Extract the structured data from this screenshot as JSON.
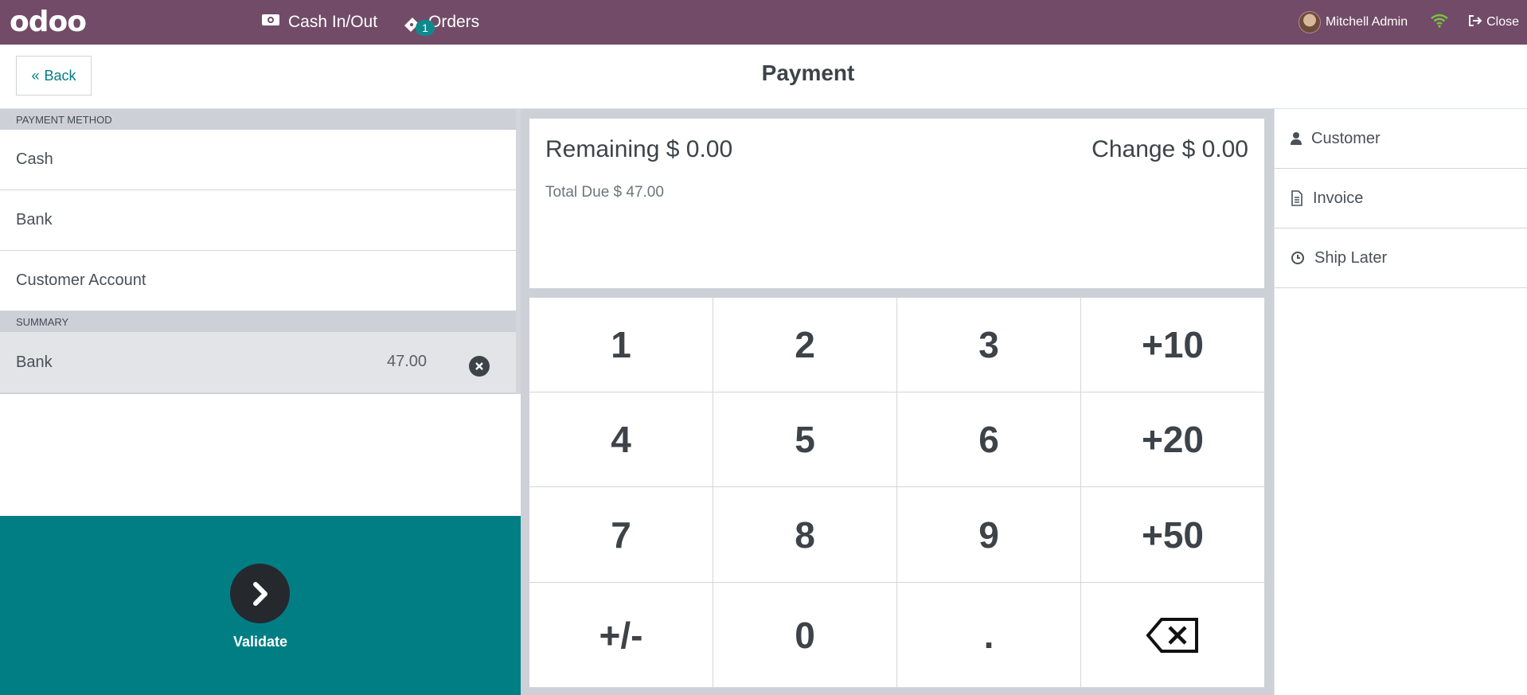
{
  "topbar": {
    "logo": "odoo",
    "cash_in_out": "Cash In/Out",
    "orders": "Orders",
    "orders_badge": "1",
    "user_name": "Mitchell Admin",
    "close": "Close"
  },
  "header": {
    "back": "Back",
    "title": "Payment"
  },
  "payment_methods": {
    "heading": "PAYMENT METHOD",
    "items": [
      "Cash",
      "Bank",
      "Customer Account"
    ]
  },
  "summary": {
    "heading": "SUMMARY",
    "line_method": "Bank",
    "line_amount": "47.00"
  },
  "validate": {
    "label": "Validate"
  },
  "status": {
    "remaining": "Remaining $ 0.00",
    "change": "Change $ 0.00",
    "total_due": "Total Due  $ 47.00"
  },
  "numpad": {
    "keys": [
      "1",
      "2",
      "3",
      "+10",
      "4",
      "5",
      "6",
      "+20",
      "7",
      "8",
      "9",
      "+50",
      "+/-",
      "0",
      ".",
      "backspace-icon"
    ]
  },
  "right_panel": {
    "customer": "Customer",
    "invoice": "Invoice",
    "ship_later": "Ship Later"
  },
  "colors": {
    "topbar": "#714b67",
    "accent": "#017e84",
    "badge": "#0f8a8c",
    "wifi": "#7ac142"
  }
}
